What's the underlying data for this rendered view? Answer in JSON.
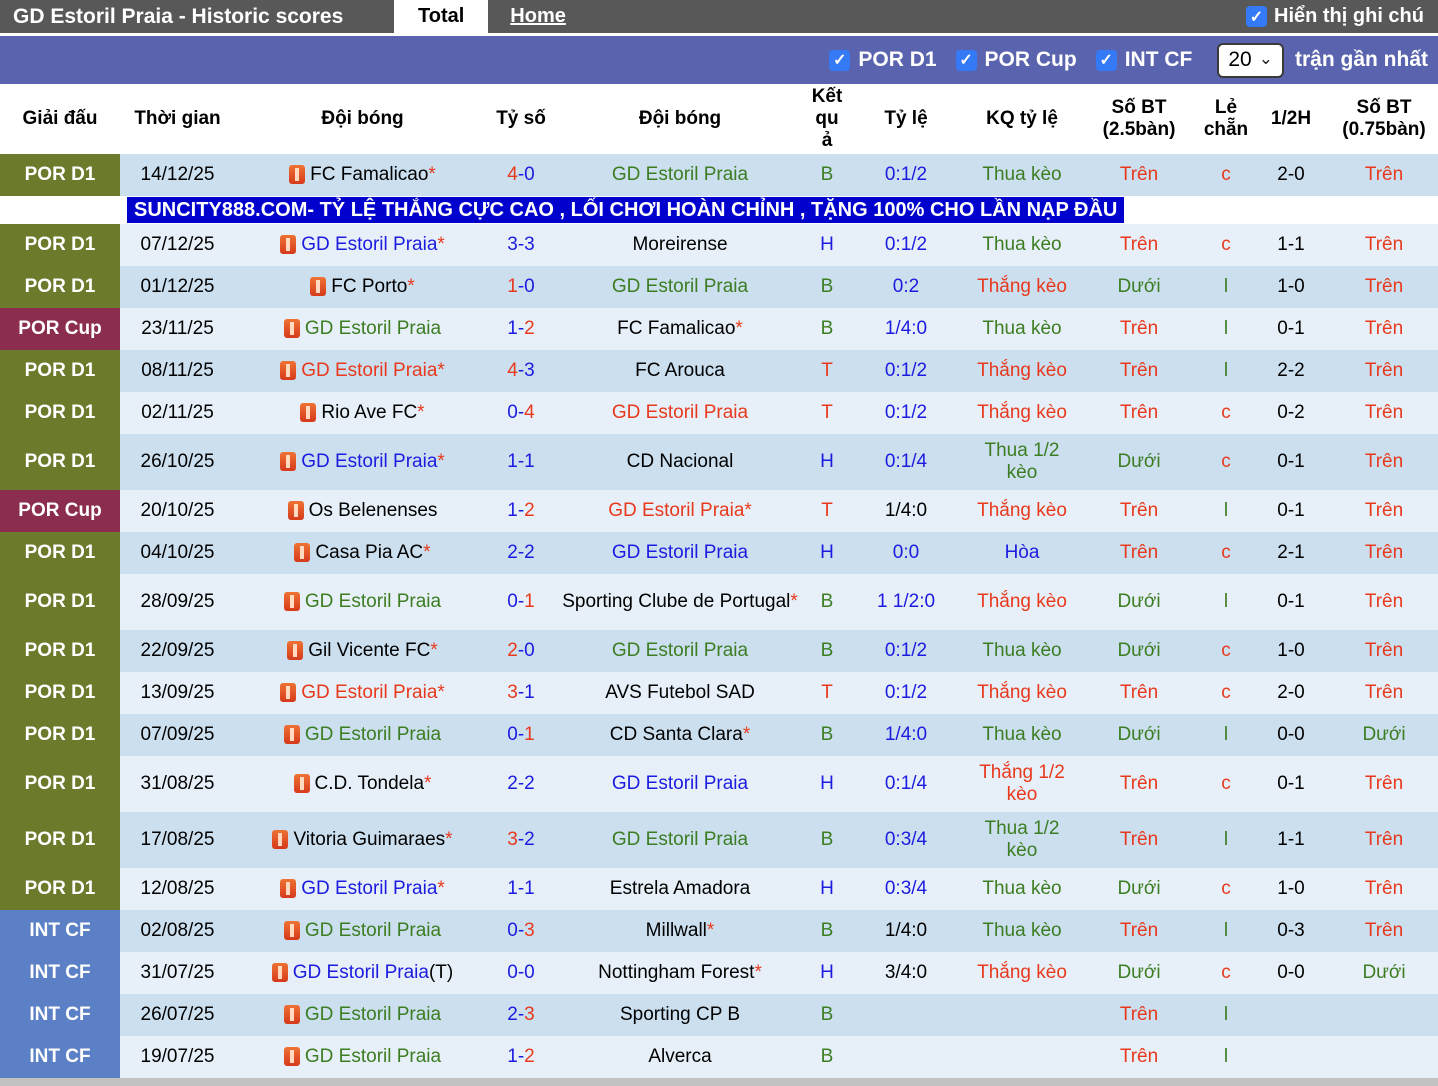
{
  "header": {
    "title": "GD Estoril Praia - Historic scores",
    "tabs": [
      {
        "label": "Total",
        "active": true
      },
      {
        "label": "Home",
        "active": false
      }
    ],
    "notes_checkbox_label": "Hiển thị ghi chú",
    "notes_checkbox_checked": true
  },
  "filter_bar": {
    "checkboxes": [
      "POR D1",
      "POR Cup",
      "INT CF"
    ],
    "all_checked": true,
    "count_select": "20",
    "count_suffix": "trận gần nhất"
  },
  "ad_banner": {
    "text": "SUNCITY888.COM- TỶ LỆ THẮNG CỰC CAO , LỐI CHƠI HOÀN CHỈNH , TẶNG 100% CHO LẦN NẠP ĐẦU"
  },
  "symbols": {
    "star": "*",
    "dash": "-"
  },
  "colors": {
    "accent_red": "#e8391d",
    "accent_green": "#3c7d22",
    "accent_blue": "#1c1ce0",
    "badge_por_d1": "#6b7a2b",
    "badge_por_cup": "#8b2d4e",
    "badge_int_cf": "#5b80c5",
    "topbar_bg": "#585858",
    "filterbar_bg": "#5a64ae",
    "row_dark": "#cbdfef",
    "row_light": "#e7f0f8",
    "ad_bg": "#0101ce",
    "checkbox_blue": "#3479f6",
    "page_gray": "#c2c2c2"
  },
  "table": {
    "columns": [
      "Giải đấu",
      "Thời gian",
      "Đội bóng",
      "Tỷ số",
      "Đội bóng",
      "Kết quả",
      "Tỷ lệ",
      "KQ tỷ lệ",
      "Số BT (2.5bàn)",
      "Lẻ chẵn",
      "1/2H",
      "Số BT (0.75bàn)"
    ],
    "rows": [
      {
        "league": "POR D1",
        "lg": "pord1",
        "date": "14/12/25",
        "home": "FC Famalicao",
        "home_star": true,
        "home_color": "black",
        "home_icon": false,
        "home_suffix": "",
        "away": "GD Estoril Praia",
        "away_star": false,
        "away_color": "green",
        "sh": "4",
        "sa": "0",
        "shc": "red",
        "sac": "blue",
        "res": "B",
        "resc": "green",
        "odds": "0:1/2",
        "oddsc": "blue",
        "kq": "Thua kèo",
        "kqc": "green",
        "bt25": "Trên",
        "bt25c": "red",
        "oe": "c",
        "oec": "red",
        "half": "2-0",
        "bt075": "Trên",
        "bt075c": "red",
        "tall": false
      },
      {
        "league": "POR D1",
        "lg": "pord1",
        "date": "07/12/25",
        "home": "GD Estoril Praia",
        "home_star": true,
        "home_color": "blue",
        "home_icon": false,
        "home_suffix": "",
        "away": "Moreirense",
        "away_star": false,
        "away_color": "black",
        "sh": "3",
        "sa": "3",
        "shc": "blue",
        "sac": "blue",
        "res": "H",
        "resc": "blue",
        "odds": "0:1/2",
        "oddsc": "blue",
        "kq": "Thua kèo",
        "kqc": "green",
        "bt25": "Trên",
        "bt25c": "red",
        "oe": "c",
        "oec": "red",
        "half": "1-1",
        "bt075": "Trên",
        "bt075c": "red",
        "tall": false
      },
      {
        "league": "POR D1",
        "lg": "pord1",
        "date": "01/12/25",
        "home": "FC Porto",
        "home_star": true,
        "home_color": "black",
        "home_icon": false,
        "home_suffix": "",
        "away": "GD Estoril Praia",
        "away_star": false,
        "away_color": "green",
        "sh": "1",
        "sa": "0",
        "shc": "red",
        "sac": "blue",
        "res": "B",
        "resc": "green",
        "odds": "0:2",
        "oddsc": "blue",
        "kq": "Thắng kèo",
        "kqc": "red",
        "bt25": "Dưới",
        "bt25c": "green",
        "oe": "l",
        "oec": "green",
        "half": "1-0",
        "bt075": "Trên",
        "bt075c": "red",
        "tall": false
      },
      {
        "league": "POR Cup",
        "lg": "porcup",
        "date": "23/11/25",
        "home": "GD Estoril Praia",
        "home_star": false,
        "home_color": "green",
        "home_icon": false,
        "home_suffix": "",
        "away": "FC Famalicao",
        "away_star": true,
        "away_color": "black",
        "sh": "1",
        "sa": "2",
        "shc": "blue",
        "sac": "red",
        "res": "B",
        "resc": "green",
        "odds": "1/4:0",
        "oddsc": "blue",
        "kq": "Thua kèo",
        "kqc": "green",
        "bt25": "Trên",
        "bt25c": "red",
        "oe": "l",
        "oec": "green",
        "half": "0-1",
        "bt075": "Trên",
        "bt075c": "red",
        "tall": false
      },
      {
        "league": "POR D1",
        "lg": "pord1",
        "date": "08/11/25",
        "home": "GD Estoril Praia",
        "home_star": true,
        "home_color": "red",
        "home_icon": false,
        "home_suffix": "",
        "away": "FC Arouca",
        "away_star": false,
        "away_color": "black",
        "sh": "4",
        "sa": "3",
        "shc": "red",
        "sac": "blue",
        "res": "T",
        "resc": "red",
        "odds": "0:1/2",
        "oddsc": "blue",
        "kq": "Thắng kèo",
        "kqc": "red",
        "bt25": "Trên",
        "bt25c": "red",
        "oe": "l",
        "oec": "green",
        "half": "2-2",
        "bt075": "Trên",
        "bt075c": "red",
        "tall": false
      },
      {
        "league": "POR D1",
        "lg": "pord1",
        "date": "02/11/25",
        "home": "Rio Ave FC",
        "home_star": true,
        "home_color": "black",
        "home_icon": true,
        "home_suffix": "",
        "away": "GD Estoril Praia",
        "away_star": false,
        "away_color": "red",
        "sh": "0",
        "sa": "4",
        "shc": "blue",
        "sac": "red",
        "res": "T",
        "resc": "red",
        "odds": "0:1/2",
        "oddsc": "blue",
        "kq": "Thắng kèo",
        "kqc": "red",
        "bt25": "Trên",
        "bt25c": "red",
        "oe": "c",
        "oec": "red",
        "half": "0-2",
        "bt075": "Trên",
        "bt075c": "red",
        "tall": false
      },
      {
        "league": "POR D1",
        "lg": "pord1",
        "date": "26/10/25",
        "home": "GD Estoril Praia",
        "home_star": true,
        "home_color": "blue",
        "home_icon": false,
        "home_suffix": "",
        "away": "CD Nacional",
        "away_star": false,
        "away_color": "black",
        "sh": "1",
        "sa": "1",
        "shc": "blue",
        "sac": "blue",
        "res": "H",
        "resc": "blue",
        "odds": "0:1/4",
        "oddsc": "blue",
        "kq": "Thua 1/2 kèo",
        "kqc": "green",
        "bt25": "Dưới",
        "bt25c": "green",
        "oe": "c",
        "oec": "red",
        "half": "0-1",
        "bt075": "Trên",
        "bt075c": "red",
        "tall": true
      },
      {
        "league": "POR Cup",
        "lg": "porcup",
        "date": "20/10/25",
        "home": "Os Belenenses",
        "home_star": false,
        "home_color": "black",
        "home_icon": false,
        "home_suffix": "",
        "away": "GD Estoril Praia",
        "away_star": true,
        "away_color": "red",
        "sh": "1",
        "sa": "2",
        "shc": "blue",
        "sac": "red",
        "res": "T",
        "resc": "red",
        "odds": "1/4:0",
        "oddsc": "black",
        "kq": "Thắng kèo",
        "kqc": "red",
        "bt25": "Trên",
        "bt25c": "red",
        "oe": "l",
        "oec": "green",
        "half": "0-1",
        "bt075": "Trên",
        "bt075c": "red",
        "tall": false
      },
      {
        "league": "POR D1",
        "lg": "pord1",
        "date": "04/10/25",
        "home": "Casa Pia AC",
        "home_star": true,
        "home_color": "black",
        "home_icon": false,
        "home_suffix": "",
        "away": "GD Estoril Praia",
        "away_star": false,
        "away_color": "blue",
        "sh": "2",
        "sa": "2",
        "shc": "blue",
        "sac": "blue",
        "res": "H",
        "resc": "blue",
        "odds": "0:0",
        "oddsc": "blue",
        "kq": "Hòa",
        "kqc": "blue",
        "bt25": "Trên",
        "bt25c": "red",
        "oe": "c",
        "oec": "red",
        "half": "2-1",
        "bt075": "Trên",
        "bt075c": "red",
        "tall": false
      },
      {
        "league": "POR D1",
        "lg": "pord1",
        "date": "28/09/25",
        "home": "GD Estoril Praia",
        "home_star": false,
        "home_color": "green",
        "home_icon": false,
        "home_suffix": "",
        "away": "Sporting Clube de Portugal",
        "away_star": true,
        "away_color": "black",
        "sh": "0",
        "sa": "1",
        "shc": "blue",
        "sac": "red",
        "res": "B",
        "resc": "green",
        "odds": "1 1/2:0",
        "oddsc": "blue",
        "kq": "Thắng kèo",
        "kqc": "red",
        "bt25": "Dưới",
        "bt25c": "green",
        "oe": "l",
        "oec": "green",
        "half": "0-1",
        "bt075": "Trên",
        "bt075c": "red",
        "tall": true
      },
      {
        "league": "POR D1",
        "lg": "pord1",
        "date": "22/09/25",
        "home": "Gil Vicente FC",
        "home_star": true,
        "home_color": "black",
        "home_icon": false,
        "home_suffix": "",
        "away": "GD Estoril Praia",
        "away_star": false,
        "away_color": "green",
        "sh": "2",
        "sa": "0",
        "shc": "red",
        "sac": "blue",
        "res": "B",
        "resc": "green",
        "odds": "0:1/2",
        "oddsc": "blue",
        "kq": "Thua kèo",
        "kqc": "green",
        "bt25": "Dưới",
        "bt25c": "green",
        "oe": "c",
        "oec": "red",
        "half": "1-0",
        "bt075": "Trên",
        "bt075c": "red",
        "tall": false
      },
      {
        "league": "POR D1",
        "lg": "pord1",
        "date": "13/09/25",
        "home": "GD Estoril Praia",
        "home_star": true,
        "home_color": "red",
        "home_icon": false,
        "home_suffix": "",
        "away": "AVS Futebol SAD",
        "away_star": false,
        "away_color": "black",
        "sh": "3",
        "sa": "1",
        "shc": "red",
        "sac": "blue",
        "res": "T",
        "resc": "red",
        "odds": "0:1/2",
        "oddsc": "blue",
        "kq": "Thắng kèo",
        "kqc": "red",
        "bt25": "Trên",
        "bt25c": "red",
        "oe": "c",
        "oec": "red",
        "half": "2-0",
        "bt075": "Trên",
        "bt075c": "red",
        "tall": false
      },
      {
        "league": "POR D1",
        "lg": "pord1",
        "date": "07/09/25",
        "home": "GD Estoril Praia",
        "home_star": false,
        "home_color": "green",
        "home_icon": false,
        "home_suffix": "",
        "away": "CD Santa Clara",
        "away_star": true,
        "away_color": "black",
        "sh": "0",
        "sa": "1",
        "shc": "blue",
        "sac": "red",
        "res": "B",
        "resc": "green",
        "odds": "1/4:0",
        "oddsc": "blue",
        "kq": "Thua kèo",
        "kqc": "green",
        "bt25": "Dưới",
        "bt25c": "green",
        "oe": "l",
        "oec": "green",
        "half": "0-0",
        "bt075": "Dưới",
        "bt075c": "green",
        "tall": false
      },
      {
        "league": "POR D1",
        "lg": "pord1",
        "date": "31/08/25",
        "home": "C.D. Tondela",
        "home_star": true,
        "home_color": "black",
        "home_icon": false,
        "home_suffix": "",
        "away": "GD Estoril Praia",
        "away_star": false,
        "away_color": "blue",
        "sh": "2",
        "sa": "2",
        "shc": "blue",
        "sac": "blue",
        "res": "H",
        "resc": "blue",
        "odds": "0:1/4",
        "oddsc": "blue",
        "kq": "Thắng 1/2 kèo",
        "kqc": "red",
        "bt25": "Trên",
        "bt25c": "red",
        "oe": "c",
        "oec": "red",
        "half": "0-1",
        "bt075": "Trên",
        "bt075c": "red",
        "tall": true
      },
      {
        "league": "POR D1",
        "lg": "pord1",
        "date": "17/08/25",
        "home": "Vitoria Guimaraes",
        "home_star": true,
        "home_color": "black",
        "home_icon": false,
        "home_suffix": "",
        "away": "GD Estoril Praia",
        "away_star": false,
        "away_color": "green",
        "sh": "3",
        "sa": "2",
        "shc": "red",
        "sac": "blue",
        "res": "B",
        "resc": "green",
        "odds": "0:3/4",
        "oddsc": "blue",
        "kq": "Thua 1/2 kèo",
        "kqc": "green",
        "bt25": "Trên",
        "bt25c": "red",
        "oe": "l",
        "oec": "green",
        "half": "1-1",
        "bt075": "Trên",
        "bt075c": "red",
        "tall": true
      },
      {
        "league": "POR D1",
        "lg": "pord1",
        "date": "12/08/25",
        "home": "GD Estoril Praia",
        "home_star": true,
        "home_color": "blue",
        "home_icon": false,
        "home_suffix": "",
        "away": "Estrela Amadora",
        "away_star": false,
        "away_color": "black",
        "sh": "1",
        "sa": "1",
        "shc": "blue",
        "sac": "blue",
        "res": "H",
        "resc": "blue",
        "odds": "0:3/4",
        "oddsc": "blue",
        "kq": "Thua kèo",
        "kqc": "green",
        "bt25": "Dưới",
        "bt25c": "green",
        "oe": "c",
        "oec": "red",
        "half": "1-0",
        "bt075": "Trên",
        "bt075c": "red",
        "tall": false
      },
      {
        "league": "INT CF",
        "lg": "intcf",
        "date": "02/08/25",
        "home": "GD Estoril Praia",
        "home_star": false,
        "home_color": "green",
        "home_icon": false,
        "home_suffix": "",
        "away": "Millwall",
        "away_star": true,
        "away_color": "black",
        "sh": "0",
        "sa": "3",
        "shc": "blue",
        "sac": "red",
        "res": "B",
        "resc": "green",
        "odds": "1/4:0",
        "oddsc": "black",
        "kq": "Thua kèo",
        "kqc": "green",
        "bt25": "Trên",
        "bt25c": "red",
        "oe": "l",
        "oec": "green",
        "half": "0-3",
        "bt075": "Trên",
        "bt075c": "red",
        "tall": false
      },
      {
        "league": "INT CF",
        "lg": "intcf",
        "date": "31/07/25",
        "home": "GD Estoril Praia",
        "home_star": false,
        "home_color": "blue",
        "home_icon": false,
        "home_suffix": "(T)",
        "away": "Nottingham Forest",
        "away_star": true,
        "away_color": "black",
        "sh": "0",
        "sa": "0",
        "shc": "blue",
        "sac": "blue",
        "res": "H",
        "resc": "blue",
        "odds": "3/4:0",
        "oddsc": "black",
        "kq": "Thắng kèo",
        "kqc": "red",
        "bt25": "Dưới",
        "bt25c": "green",
        "oe": "c",
        "oec": "red",
        "half": "0-0",
        "bt075": "Dưới",
        "bt075c": "green",
        "tall": false
      },
      {
        "league": "INT CF",
        "lg": "intcf",
        "date": "26/07/25",
        "home": "GD Estoril Praia",
        "home_star": false,
        "home_color": "green",
        "home_icon": false,
        "home_suffix": "",
        "away": "Sporting CP B",
        "away_star": false,
        "away_color": "black",
        "sh": "2",
        "sa": "3",
        "shc": "blue",
        "sac": "red",
        "res": "B",
        "resc": "green",
        "odds": "",
        "oddsc": "blue",
        "kq": "",
        "kqc": "green",
        "bt25": "Trên",
        "bt25c": "red",
        "oe": "l",
        "oec": "green",
        "half": "",
        "bt075": "",
        "bt075c": "red",
        "tall": false
      },
      {
        "league": "INT CF",
        "lg": "intcf",
        "date": "19/07/25",
        "home": "GD Estoril Praia",
        "home_star": false,
        "home_color": "green",
        "home_icon": false,
        "home_suffix": "",
        "away": "Alverca",
        "away_star": false,
        "away_color": "black",
        "sh": "1",
        "sa": "2",
        "shc": "blue",
        "sac": "red",
        "res": "B",
        "resc": "green",
        "odds": "",
        "oddsc": "blue",
        "kq": "",
        "kqc": "green",
        "bt25": "Trên",
        "bt25c": "red",
        "oe": "l",
        "oec": "green",
        "half": "",
        "bt075": "",
        "bt075c": "red",
        "tall": false
      }
    ]
  }
}
